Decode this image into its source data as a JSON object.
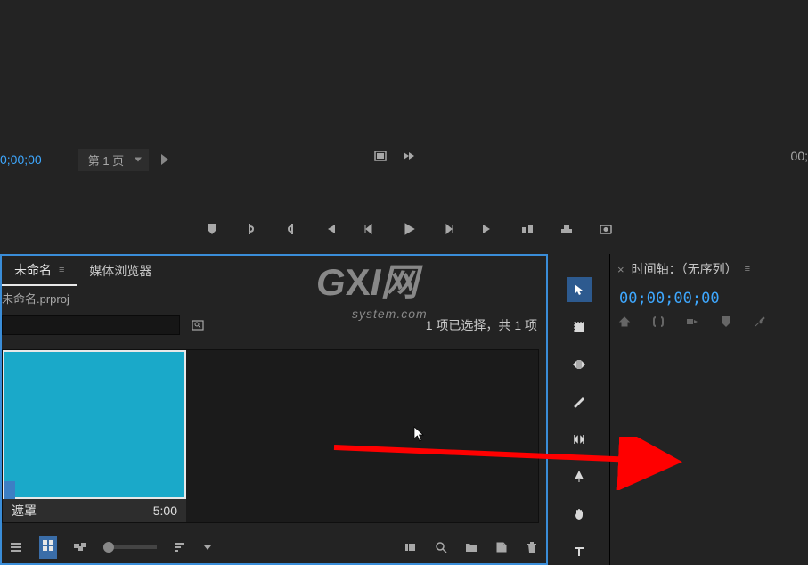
{
  "monitor": {
    "timecode_left": "0;00;00",
    "page_dropdown": "第 1 页",
    "timecode_right": "00;"
  },
  "project": {
    "tab_name": "未命名",
    "media_browser_tab": "媒体浏览器",
    "file_name": "未命名.prproj",
    "selection_info": "1 项已选择，共 1 项",
    "clip": {
      "name": "遮罩",
      "duration": "5:00"
    }
  },
  "timeline": {
    "title": "时间轴：（无序列）",
    "timecode": "00;00;00;00"
  },
  "watermark": {
    "line1_a": "G",
    "line1_b": "X",
    "line1_c": "I",
    "line1_d": "网",
    "line2": "system.com"
  }
}
